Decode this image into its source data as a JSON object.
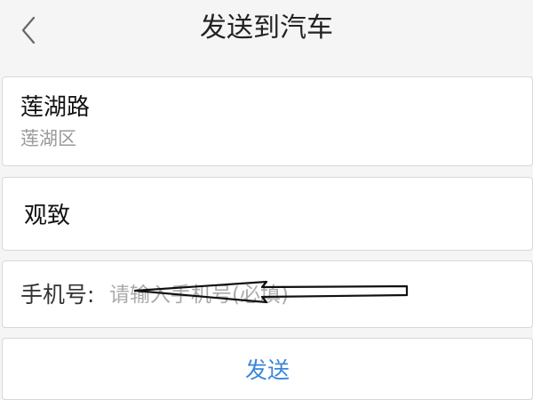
{
  "header": {
    "title": "发送到汽车",
    "back_icon": "chevron-left-icon"
  },
  "address": {
    "name": "莲湖路",
    "district": "莲湖区"
  },
  "car": {
    "name": "观致"
  },
  "phone": {
    "label": "手机号:",
    "placeholder": "请输入手机号(必填)",
    "value": ""
  },
  "send_button": {
    "label": "发送"
  },
  "colors": {
    "accent": "#3a86d9",
    "background": "#f5f5f5",
    "card": "#ffffff",
    "border": "#d8d8d8"
  }
}
